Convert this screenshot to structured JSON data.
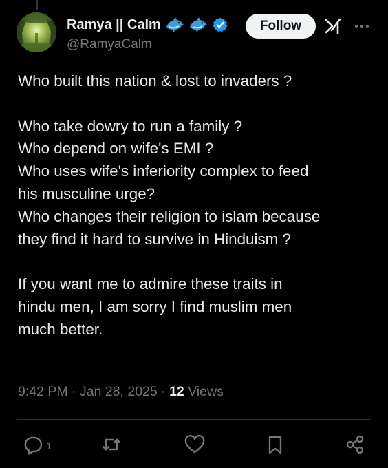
{
  "profile": {
    "display_name": "Ramya || Calm",
    "handle": "@RamyaCalm",
    "badge_icons": [
      "dolphin-emoji",
      "dolphin-emoji",
      "verified-badge-icon"
    ],
    "follow_label": "Follow"
  },
  "tweet": {
    "lines": [
      "Who built this nation & lost to invaders ?",
      "",
      "Who take dowry to run a family ?",
      "Who depend on wife's EMI ?",
      "Who uses wife's inferiority complex to feed",
      "his musculine urge?",
      "Who changes their religion to islam because",
      "they find it hard to survive in Hinduism ?",
      "",
      "If you want me to admire these traits in",
      "hindu men, I am sorry I find muslim men",
      "much better."
    ]
  },
  "meta": {
    "time": "9:42 PM",
    "separator": " · ",
    "date": "Jan 28, 2025",
    "views_count": "12",
    "views_label": " Views"
  },
  "actions": {
    "reply_count": "1",
    "icons": [
      "reply-icon",
      "retweet-icon",
      "like-icon",
      "bookmark-icon",
      "share-icon"
    ]
  },
  "colors": {
    "background": "#000000",
    "text_primary": "#e7e9ea",
    "text_secondary": "#71767b",
    "divider": "#2f3336",
    "verified": "#1d9bf0",
    "follow_bg": "#eff3f4"
  }
}
